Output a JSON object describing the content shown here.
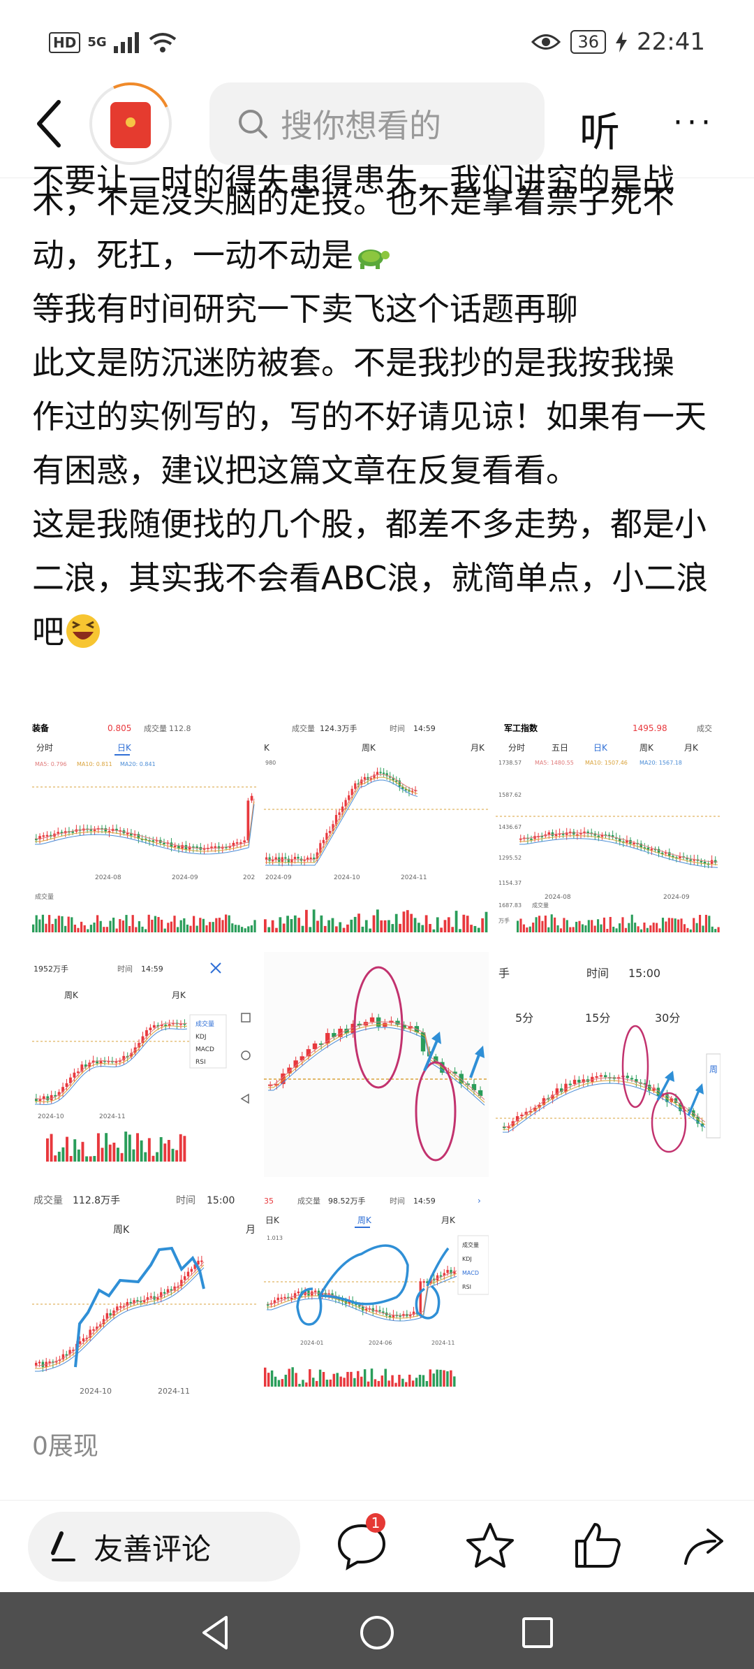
{
  "status_bar": {
    "hd": "HD",
    "network": "5G",
    "battery": "36",
    "time": "22:41"
  },
  "header": {
    "search_placeholder": "搜你想看的",
    "listen_label": "听",
    "more_label": "···"
  },
  "article": {
    "lines": [
      "不要让一时的得失患得患失，我们讲究的是战",
      "术，不是没头脑的定投。也不是拿着票子死不",
      "动，死扛，一动不动是",
      "等我有时间研究一下卖飞这个话题再聊",
      "此文是防沉迷防被套。不是我抄的是我按我操",
      "作过的实例写的，写的不好请见谅！如果有一天",
      "有困惑，建议把这篇文章在反复看看。",
      "这是我随便找的几个股，都差不多走势，都是小",
      "二浪，其实我不会看ABC浪，就简单点，小二浪",
      "吧"
    ]
  },
  "images": [
    {
      "top": [
        "装备",
        "0.805",
        "成交量",
        "112.8"
      ],
      "tabs": [
        "分时",
        "日K"
      ],
      "ma": [
        "MA5: 0.796",
        "MA10: 0.811",
        "MA20: 0.841"
      ],
      "dates": [
        "2024-08",
        "2024-09",
        "202"
      ],
      "vol_label": "成交量"
    },
    {
      "top": [
        "成交量",
        "124.3万手",
        "时间",
        "14:59"
      ],
      "tabs": [
        "K",
        "周K",
        "月K"
      ],
      "axis": "980",
      "dates": [
        "2024-09",
        "2024-10",
        "2024-11"
      ]
    },
    {
      "top": [
        "军工指数",
        "1495.98",
        "成交"
      ],
      "tabs": [
        "分时",
        "五日",
        "日K",
        "周K",
        "月K"
      ],
      "ma": [
        "MA5: 1480.55",
        "MA10: 1507.46",
        "MA20: 1567.18"
      ],
      "axis": [
        "1738.57",
        "1587.62",
        "1436.67",
        "1295.52",
        "1154.37",
        "1687.83"
      ],
      "dates": [
        "2024-08",
        "2024-09"
      ],
      "vol_label": "成交量",
      "unit": "万手"
    },
    {
      "top": [
        "1952万手",
        "时间",
        "14:59"
      ],
      "tabs": [
        "周K",
        "月K"
      ],
      "menu": [
        "成交量",
        "KDJ",
        "MACD",
        "RSI"
      ],
      "dates": [
        "2024-10",
        "2024-11"
      ]
    },
    {
      "top": []
    },
    {
      "top": [
        "手",
        "时间",
        "15:00"
      ],
      "tabs": [
        "5分",
        "15分",
        "30分"
      ],
      "edge": "周"
    },
    {
      "top": [
        "成交量",
        "112.8万手",
        "时间",
        "15:00"
      ],
      "tabs": [
        "周K",
        "月"
      ],
      "dates": [
        "2024-10",
        "2024-11"
      ]
    },
    {
      "top": [
        "35",
        "成交量",
        "98.52万手",
        "时间",
        "14:59"
      ],
      "tabs": [
        "日K",
        "周K",
        "月K"
      ],
      "axis": "1.013",
      "menu": [
        "成交量",
        "KDJ",
        "MACD",
        "RSI"
      ],
      "dates": [
        "2024-01",
        "2024-06",
        "2024-11"
      ]
    }
  ],
  "footer": {
    "views": "0展现",
    "comment_placeholder": "友善评论",
    "comment_count": "1"
  },
  "colors": {
    "up": "#e8383d",
    "down": "#2a9d5a",
    "annotation_pink": "#c2326e",
    "annotation_blue": "#2f8fd6"
  }
}
